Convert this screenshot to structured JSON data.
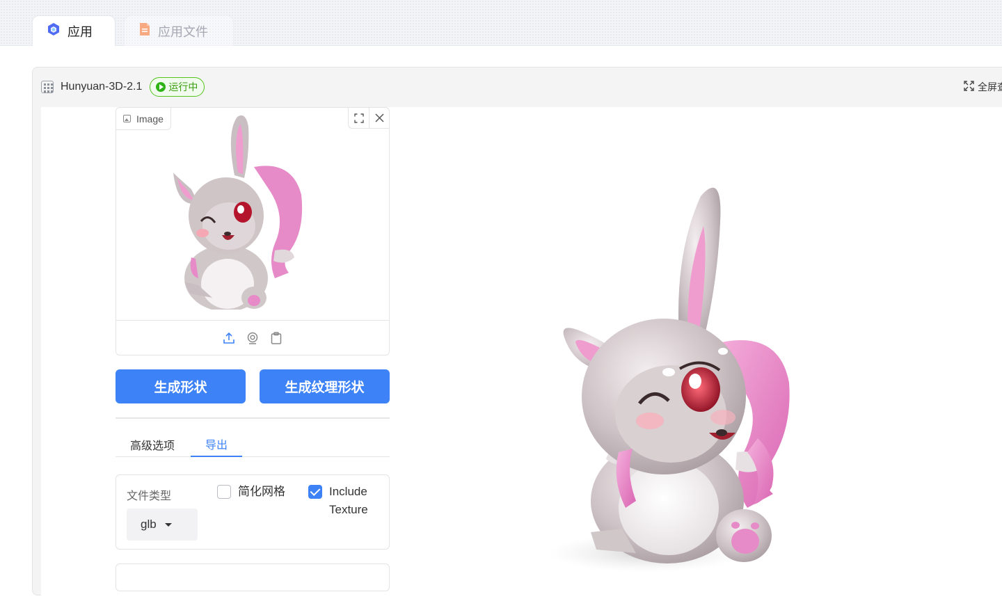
{
  "tabs": [
    {
      "label": "应用",
      "icon": "cube-icon",
      "active": true
    },
    {
      "label": "应用文件",
      "icon": "document-icon",
      "active": false
    }
  ],
  "app": {
    "name": "Hunyuan-3D-2.1",
    "status": "运行中",
    "fullscreen_label": "全屏查"
  },
  "image_input": {
    "label": "Image",
    "tools": [
      "fullscreen-icon",
      "close-icon"
    ],
    "sources": [
      "upload-icon",
      "webcam-icon",
      "clipboard-icon"
    ]
  },
  "actions": {
    "generate_shape": "生成形状",
    "generate_textured_shape": "生成纹理形状"
  },
  "option_tabs": [
    {
      "label": "高级选项",
      "active": false
    },
    {
      "label": "导出",
      "active": true
    }
  ],
  "export": {
    "file_type_label": "文件类型",
    "file_type_value": "glb",
    "simplify_mesh": {
      "label": "简化网格",
      "checked": false
    },
    "include_texture": {
      "label": "Include Texture",
      "checked": true
    }
  },
  "colors": {
    "accent": "#3d82f6",
    "status_green": "#52c41a",
    "bunny_pink": "#e87fc4",
    "bunny_grey": "#cfc4c6"
  }
}
